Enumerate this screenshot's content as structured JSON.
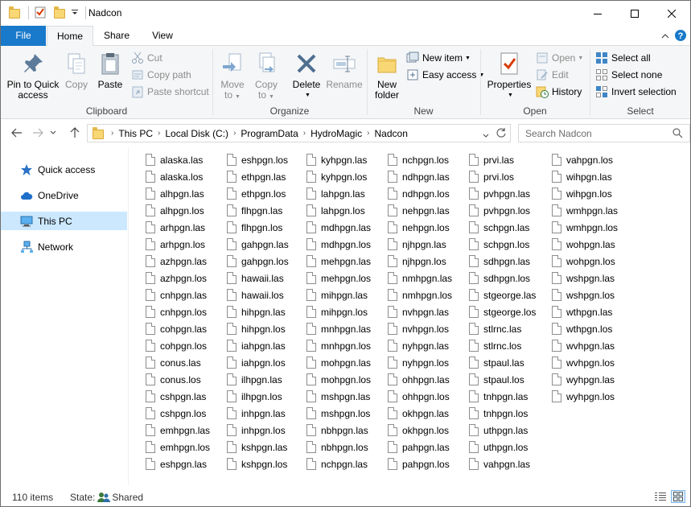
{
  "window": {
    "title": "Nadcon",
    "minimize_glyph": "—",
    "maximize_glyph": "☐",
    "close_glyph": "✕"
  },
  "ribbon_tabs": {
    "file": "File",
    "home": "Home",
    "share": "Share",
    "view": "View"
  },
  "clipboard": {
    "label": "Clipboard",
    "pin_line1": "Pin to Quick",
    "pin_line2": "access",
    "copy": "Copy",
    "paste": "Paste",
    "cut": "Cut",
    "copy_path": "Copy path",
    "paste_shortcut": "Paste shortcut"
  },
  "organize": {
    "label": "Organize",
    "move_to_line1": "Move",
    "move_to_line2": "to",
    "copy_to_line1": "Copy",
    "copy_to_line2": "to",
    "delete": "Delete",
    "rename": "Rename"
  },
  "new_group": {
    "label": "New",
    "new_folder_line1": "New",
    "new_folder_line2": "folder",
    "new_item": "New item",
    "easy_access": "Easy access"
  },
  "open_group": {
    "label": "Open",
    "properties": "Properties",
    "open": "Open",
    "edit": "Edit",
    "history": "History"
  },
  "select_group": {
    "label": "Select",
    "select_all": "Select all",
    "select_none": "Select none",
    "invert_selection": "Invert selection"
  },
  "address": {
    "crumbs": [
      "This PC",
      "Local Disk (C:)",
      "ProgramData",
      "HydroMagic",
      "Nadcon"
    ],
    "search_placeholder": "Search Nadcon"
  },
  "navpane": {
    "quick_access": "Quick access",
    "onedrive": "OneDrive",
    "this_pc": "This PC",
    "network": "Network"
  },
  "files": [
    [
      "alaska.las",
      "alaska.los",
      "alhpgn.las",
      "alhpgn.los",
      "arhpgn.las",
      "arhpgn.los",
      "azhpgn.las",
      "azhpgn.los",
      "cnhpgn.las",
      "cnhpgn.los",
      "cohpgn.las",
      "cohpgn.los",
      "conus.las",
      "conus.los",
      "cshpgn.las",
      "cshpgn.los",
      "emhpgn.las",
      "emhpgn.los",
      "eshpgn.las"
    ],
    [
      "eshpgn.los",
      "ethpgn.las",
      "ethpgn.los",
      "flhpgn.las",
      "flhpgn.los",
      "gahpgn.las",
      "gahpgn.los",
      "hawaii.las",
      "hawaii.los",
      "hihpgn.las",
      "hihpgn.los",
      "iahpgn.las",
      "iahpgn.los",
      "ilhpgn.las",
      "ilhpgn.los",
      "inhpgn.las",
      "inhpgn.los",
      "kshpgn.las",
      "kshpgn.los"
    ],
    [
      "kyhpgn.las",
      "kyhpgn.los",
      "lahpgn.las",
      "lahpgn.los",
      "mdhpgn.las",
      "mdhpgn.los",
      "mehpgn.las",
      "mehpgn.los",
      "mihpgn.las",
      "mihpgn.los",
      "mnhpgn.las",
      "mnhpgn.los",
      "mohpgn.las",
      "mohpgn.los",
      "mshpgn.las",
      "mshpgn.los",
      "nbhpgn.las",
      "nbhpgn.los",
      "nchpgn.las"
    ],
    [
      "nchpgn.los",
      "ndhpgn.las",
      "ndhpgn.los",
      "nehpgn.las",
      "nehpgn.los",
      "njhpgn.las",
      "njhpgn.los",
      "nmhpgn.las",
      "nmhpgn.los",
      "nvhpgn.las",
      "nvhpgn.los",
      "nyhpgn.las",
      "nyhpgn.los",
      "ohhpgn.las",
      "ohhpgn.los",
      "okhpgn.las",
      "okhpgn.los",
      "pahpgn.las",
      "pahpgn.los"
    ],
    [
      "prvi.las",
      "prvi.los",
      "pvhpgn.las",
      "pvhpgn.los",
      "schpgn.las",
      "schpgn.los",
      "sdhpgn.las",
      "sdhpgn.los",
      "stgeorge.las",
      "stgeorge.los",
      "stlrnc.las",
      "stlrnc.los",
      "stpaul.las",
      "stpaul.los",
      "tnhpgn.las",
      "tnhpgn.los",
      "uthpgn.las",
      "uthpgn.los",
      "vahpgn.las"
    ],
    [
      "vahpgn.los",
      "wihpgn.las",
      "wihpgn.los",
      "wmhpgn.las",
      "wmhpgn.los",
      "wohpgn.las",
      "wohpgn.los",
      "wshpgn.las",
      "wshpgn.los",
      "wthpgn.las",
      "wthpgn.los",
      "wvhpgn.las",
      "wvhpgn.los",
      "wyhpgn.las",
      "wyhpgn.los"
    ]
  ],
  "status": {
    "item_count": "110 items",
    "state_label": "State:",
    "state_value": "Shared"
  },
  "colors": {
    "accent": "#1979ca",
    "folder": "#f8d775",
    "selected": "#cce8ff"
  }
}
